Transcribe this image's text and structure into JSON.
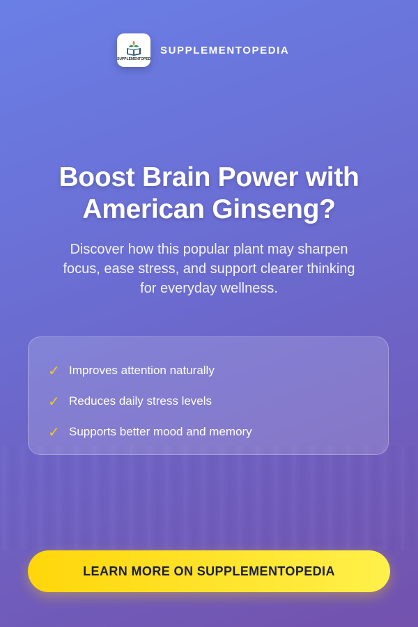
{
  "brand": {
    "name": "SUPPLEMENTOPEDIA",
    "logo_text": "SUPPLEMENTOPEDIA",
    "logo_icon": "book-with-flame-icon"
  },
  "hero": {
    "title_line1": "Boost Brain Power with",
    "title_line2": "American Ginseng?",
    "subtitle_line1": "Discover how this popular plant may sharpen",
    "subtitle_line2": "focus, ease stress, and support clearer thinking",
    "subtitle_line3": "for everyday wellness."
  },
  "benefits": {
    "check_icon": "check-icon",
    "items": [
      {
        "label": "Improves attention naturally"
      },
      {
        "label": "Reduces daily stress levels"
      },
      {
        "label": "Supports better mood and memory"
      }
    ]
  },
  "cta": {
    "label": "LEARN MORE ON SUPPLEMENTOPEDIA"
  },
  "colors": {
    "background_start": "#6a7fe6",
    "background_end": "#7352ad",
    "accent_yellow": "#ffd60a",
    "check_color": "#f5c91b",
    "cta_text": "#1c1f3a"
  }
}
